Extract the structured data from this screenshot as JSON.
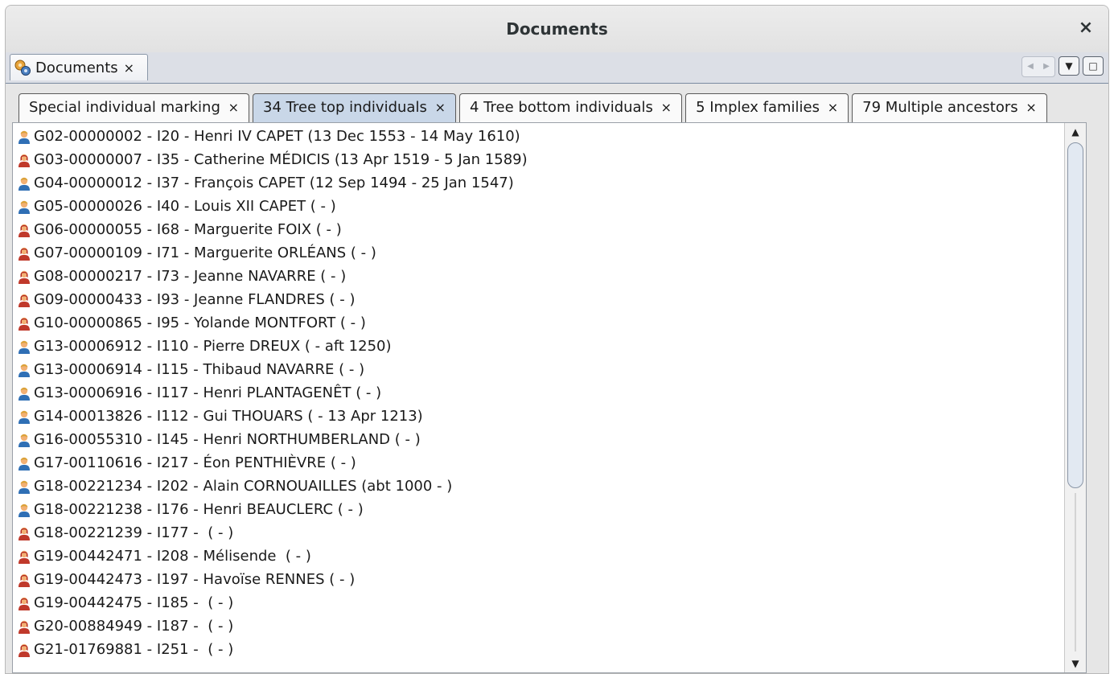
{
  "window": {
    "title": "Documents",
    "close_label": "×"
  },
  "doc_tab": {
    "label": "Documents",
    "close": "×"
  },
  "nav": {
    "prev": "◀",
    "next": "▶",
    "dropdown": "▼",
    "maximize": "□"
  },
  "sub_tabs": [
    {
      "label": "Special individual marking",
      "close": "×"
    },
    {
      "label": "34 Tree top individuals",
      "close": "×"
    },
    {
      "label": "4 Tree bottom individuals",
      "close": "×"
    },
    {
      "label": "5 Implex families",
      "close": "×"
    },
    {
      "label": "79 Multiple ancestors",
      "close": "×"
    }
  ],
  "active_sub_tab": 1,
  "colors": {
    "male": "#2f6fb5",
    "female": "#c0392b",
    "skin": "#f2b074",
    "hair_male": "#d9a235",
    "hair_female": "#b3281e"
  },
  "rows": [
    {
      "sex": "male",
      "text": "G02-00000002 - I20 - Henri IV CAPET (13 Dec 1553 - 14 May 1610)"
    },
    {
      "sex": "female",
      "text": "G03-00000007 - I35 - Catherine MÉDICIS (13 Apr 1519 - 5 Jan 1589)"
    },
    {
      "sex": "male",
      "text": "G04-00000012 - I37 - François CAPET (12 Sep 1494 - 25 Jan 1547)"
    },
    {
      "sex": "male",
      "text": "G05-00000026 - I40 - Louis XII CAPET ( - )"
    },
    {
      "sex": "female",
      "text": "G06-00000055 - I68 - Marguerite FOIX ( - )"
    },
    {
      "sex": "female",
      "text": "G07-00000109 - I71 - Marguerite ORLÉANS ( - )"
    },
    {
      "sex": "female",
      "text": "G08-00000217 - I73 - Jeanne NAVARRE ( - )"
    },
    {
      "sex": "female",
      "text": "G09-00000433 - I93 - Jeanne FLANDRES ( - )"
    },
    {
      "sex": "female",
      "text": "G10-00000865 - I95 - Yolande MONTFORT ( - )"
    },
    {
      "sex": "male",
      "text": "G13-00006912 - I110 - Pierre DREUX ( - aft 1250)"
    },
    {
      "sex": "male",
      "text": "G13-00006914 - I115 - Thibaud NAVARRE ( - )"
    },
    {
      "sex": "male",
      "text": "G13-00006916 - I117 - Henri PLANTAGENÊT ( - )"
    },
    {
      "sex": "male",
      "text": "G14-00013826 - I112 - Gui THOUARS ( - 13 Apr 1213)"
    },
    {
      "sex": "male",
      "text": "G16-00055310 - I145 - Henri NORTHUMBERLAND ( - )"
    },
    {
      "sex": "male",
      "text": "G17-00110616 - I217 - Éon PENTHIÈVRE ( - )"
    },
    {
      "sex": "male",
      "text": "G18-00221234 - I202 - Alain CORNOUAILLES (abt 1000 - )"
    },
    {
      "sex": "male",
      "text": "G18-00221238 - I176 - Henri BEAUCLERC ( - )"
    },
    {
      "sex": "female",
      "text": "G18-00221239 - I177 -  ( - )"
    },
    {
      "sex": "female",
      "text": "G19-00442471 - I208 - Mélisende  ( - )"
    },
    {
      "sex": "female",
      "text": "G19-00442473 - I197 - Havoïse RENNES ( - )"
    },
    {
      "sex": "female",
      "text": "G19-00442475 - I185 -  ( - )"
    },
    {
      "sex": "female",
      "text": "G20-00884949 - I187 -  ( - )"
    },
    {
      "sex": "female",
      "text": "G21-01769881 - I251 -  ( - )"
    }
  ],
  "scrollbar": {
    "up": "▲",
    "down": "▼"
  }
}
